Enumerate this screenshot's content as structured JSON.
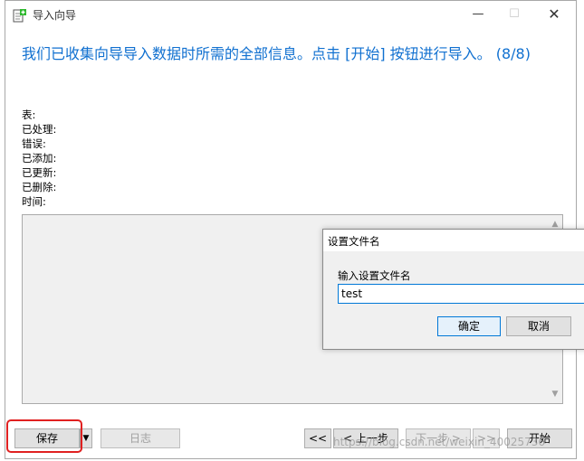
{
  "window": {
    "title": "导入向导",
    "controls": {
      "minimize": "—",
      "maximize": "☐",
      "close": "✕"
    }
  },
  "headline": "我们已收集向导导入数据时所需的全部信息。点击 [开始] 按钮进行导入。 (8/8)",
  "stats": [
    {
      "label": "表:"
    },
    {
      "label": "已处理:"
    },
    {
      "label": "错误:"
    },
    {
      "label": "已添加:"
    },
    {
      "label": "已更新:"
    },
    {
      "label": "已删除:"
    },
    {
      "label": "时间:"
    }
  ],
  "footer": {
    "save_label": "保存",
    "save_dropdown": "▼",
    "log_label": "日志",
    "first_label": "<<",
    "prev_label": "< 上一步",
    "next_label": "下一步 >",
    "last_label": ">>",
    "start_label": "开始"
  },
  "dialog": {
    "title": "设置文件名",
    "label": "输入设置文件名",
    "input_value": "test",
    "ok_label": "确定",
    "cancel_label": "取消"
  },
  "watermark": "https://blog.csdn.net/weixin_40025736",
  "colors": {
    "accent": "#1070d0",
    "highlight": "#e02020"
  }
}
